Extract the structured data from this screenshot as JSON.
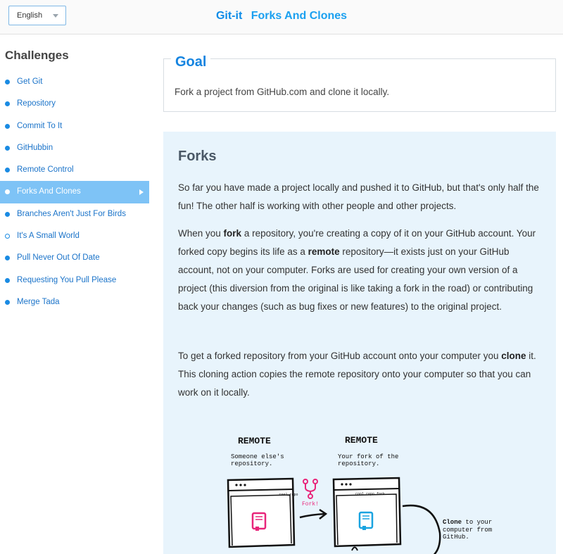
{
  "header": {
    "language": "English",
    "app_name": "Git-it",
    "page_title": "Forks And Clones"
  },
  "sidebar": {
    "heading": "Challenges",
    "items": [
      {
        "label": "Get Git",
        "state": "done"
      },
      {
        "label": "Repository",
        "state": "done"
      },
      {
        "label": "Commit To It",
        "state": "done"
      },
      {
        "label": "GitHubbin",
        "state": "done"
      },
      {
        "label": "Remote Control",
        "state": "done"
      },
      {
        "label": "Forks And Clones",
        "state": "active"
      },
      {
        "label": "Branches Aren't Just For Birds",
        "state": "done"
      },
      {
        "label": "It's A Small World",
        "state": "incomplete"
      },
      {
        "label": "Pull Never Out Of Date",
        "state": "done"
      },
      {
        "label": "Requesting You Pull Please",
        "state": "done"
      },
      {
        "label": "Merge Tada",
        "state": "done"
      }
    ]
  },
  "goal": {
    "title": "Goal",
    "text": "Fork a project from GitHub.com and clone it locally."
  },
  "content": {
    "heading": "Forks",
    "p1": "So far you have made a project locally and pushed it to GitHub, but that's only half the fun! The other half is working with other people and other projects.",
    "p2": {
      "a": "When you ",
      "b": "fork",
      "c": " a repository, you're creating a copy of it on your GitHub account. Your forked copy begins its life as a ",
      "d": "remote",
      "e": " repository—it exists just on your GitHub account, not on your computer. Forks are used for creating your own version of a project (this diversion from the original is like taking a fork in the road) or contributing back your changes (such as bug fixes or new features) to the original project."
    },
    "p3": {
      "a": "To get a forked repository from your GitHub account onto your computer you ",
      "b": "clone",
      "c": " it. This cloning action copies the remote repository onto your computer so that you can work on it locally."
    }
  },
  "illustration": {
    "left_label": "REMOTE",
    "left_caption": "Someone else's repository.",
    "left_repo": "cool_repo",
    "fork_label": "Fork!",
    "right_label": "REMOTE",
    "right_caption": "Your fork of the repository.",
    "right_repo": "cool_repo.fork",
    "clone_bold": "Clone",
    "clone_rest": " to your computer from GitHub.",
    "colors": {
      "fork": "#e8257a",
      "book_left": "#e8257a",
      "book_right": "#19a3e0"
    }
  }
}
